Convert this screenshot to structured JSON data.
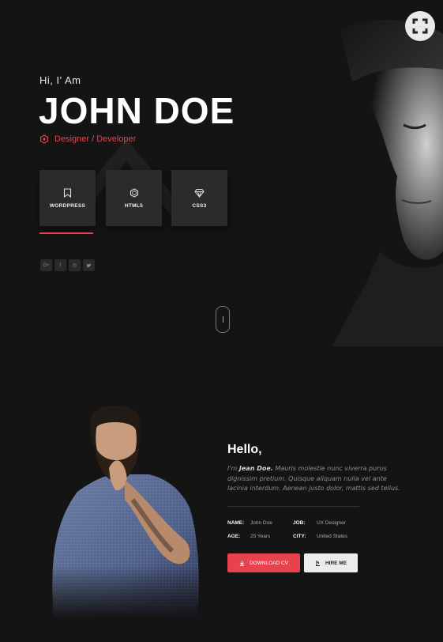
{
  "hero": {
    "greeting": "Hi, I' Am",
    "name": "JOHN DOE",
    "role": "Designer / Developer"
  },
  "skills": [
    {
      "label": "WORDPRESS",
      "icon": "bookmark-icon"
    },
    {
      "label": "HTML5",
      "icon": "hexagon-icon"
    },
    {
      "label": "CSS3",
      "icon": "diamond-icon"
    }
  ],
  "social": [
    {
      "label": "G+",
      "icon": "google-plus-icon"
    },
    {
      "label": "t",
      "icon": "tumblr-icon"
    },
    {
      "label": "◎",
      "icon": "dribbble-icon"
    },
    {
      "label": "🐦",
      "icon": "twitter-icon"
    }
  ],
  "about": {
    "heading": "Hello,",
    "intro_prefix": "I'm",
    "intro_name": "Jean Doe.",
    "intro_text": "Mauris molestie nunc viverra purus dignissim pretium. Quisque aliquam nulla vel ante lacinia interdum. Aenean justo dolor, mattis sed tellus.",
    "info": {
      "name_key": "NAME:",
      "name_val": "John Doe",
      "job_key": "JOB:",
      "job_val": "UX Designer",
      "age_key": "AGE:",
      "age_val": "25 Years",
      "city_key": "CITY:",
      "city_val": "United States"
    },
    "download_label": "DOWNLOAD CV",
    "hire_label": "HIRE ME"
  },
  "colors": {
    "accent": "#e8424c",
    "background": "#141414",
    "tile": "#2b2b2b"
  }
}
